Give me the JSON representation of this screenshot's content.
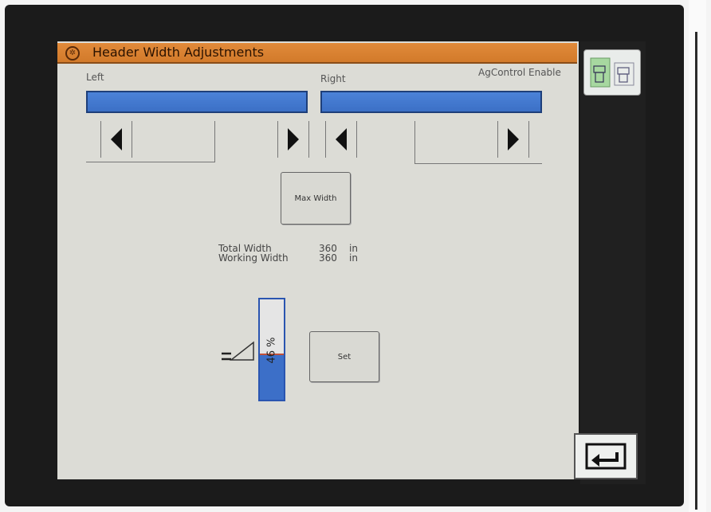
{
  "header": {
    "title": "Header Width Adjustments",
    "icon": "gear-icon",
    "accent_color": "#d9822f"
  },
  "left": {
    "label": "Left"
  },
  "right": {
    "label": "Right"
  },
  "agcontrol": {
    "label": "AgControl Enable"
  },
  "max_width_button": {
    "label": "Max Width"
  },
  "widths": {
    "total_label": "Total Width",
    "total_value": "360",
    "total_unit": "in",
    "working_label": "Working Width",
    "working_value": "360",
    "working_unit": "in"
  },
  "tilt": {
    "percent": 46,
    "text": "46 %",
    "icon": "tilt-level-icon"
  },
  "set_button": {
    "label": "Set"
  },
  "sidebar": {
    "enable_icon": "header-enable-icon",
    "back_icon": "return-arrow-icon"
  },
  "colors": {
    "bar_blue": "#3f74cc",
    "screen_bg": "#dcdcd6"
  }
}
